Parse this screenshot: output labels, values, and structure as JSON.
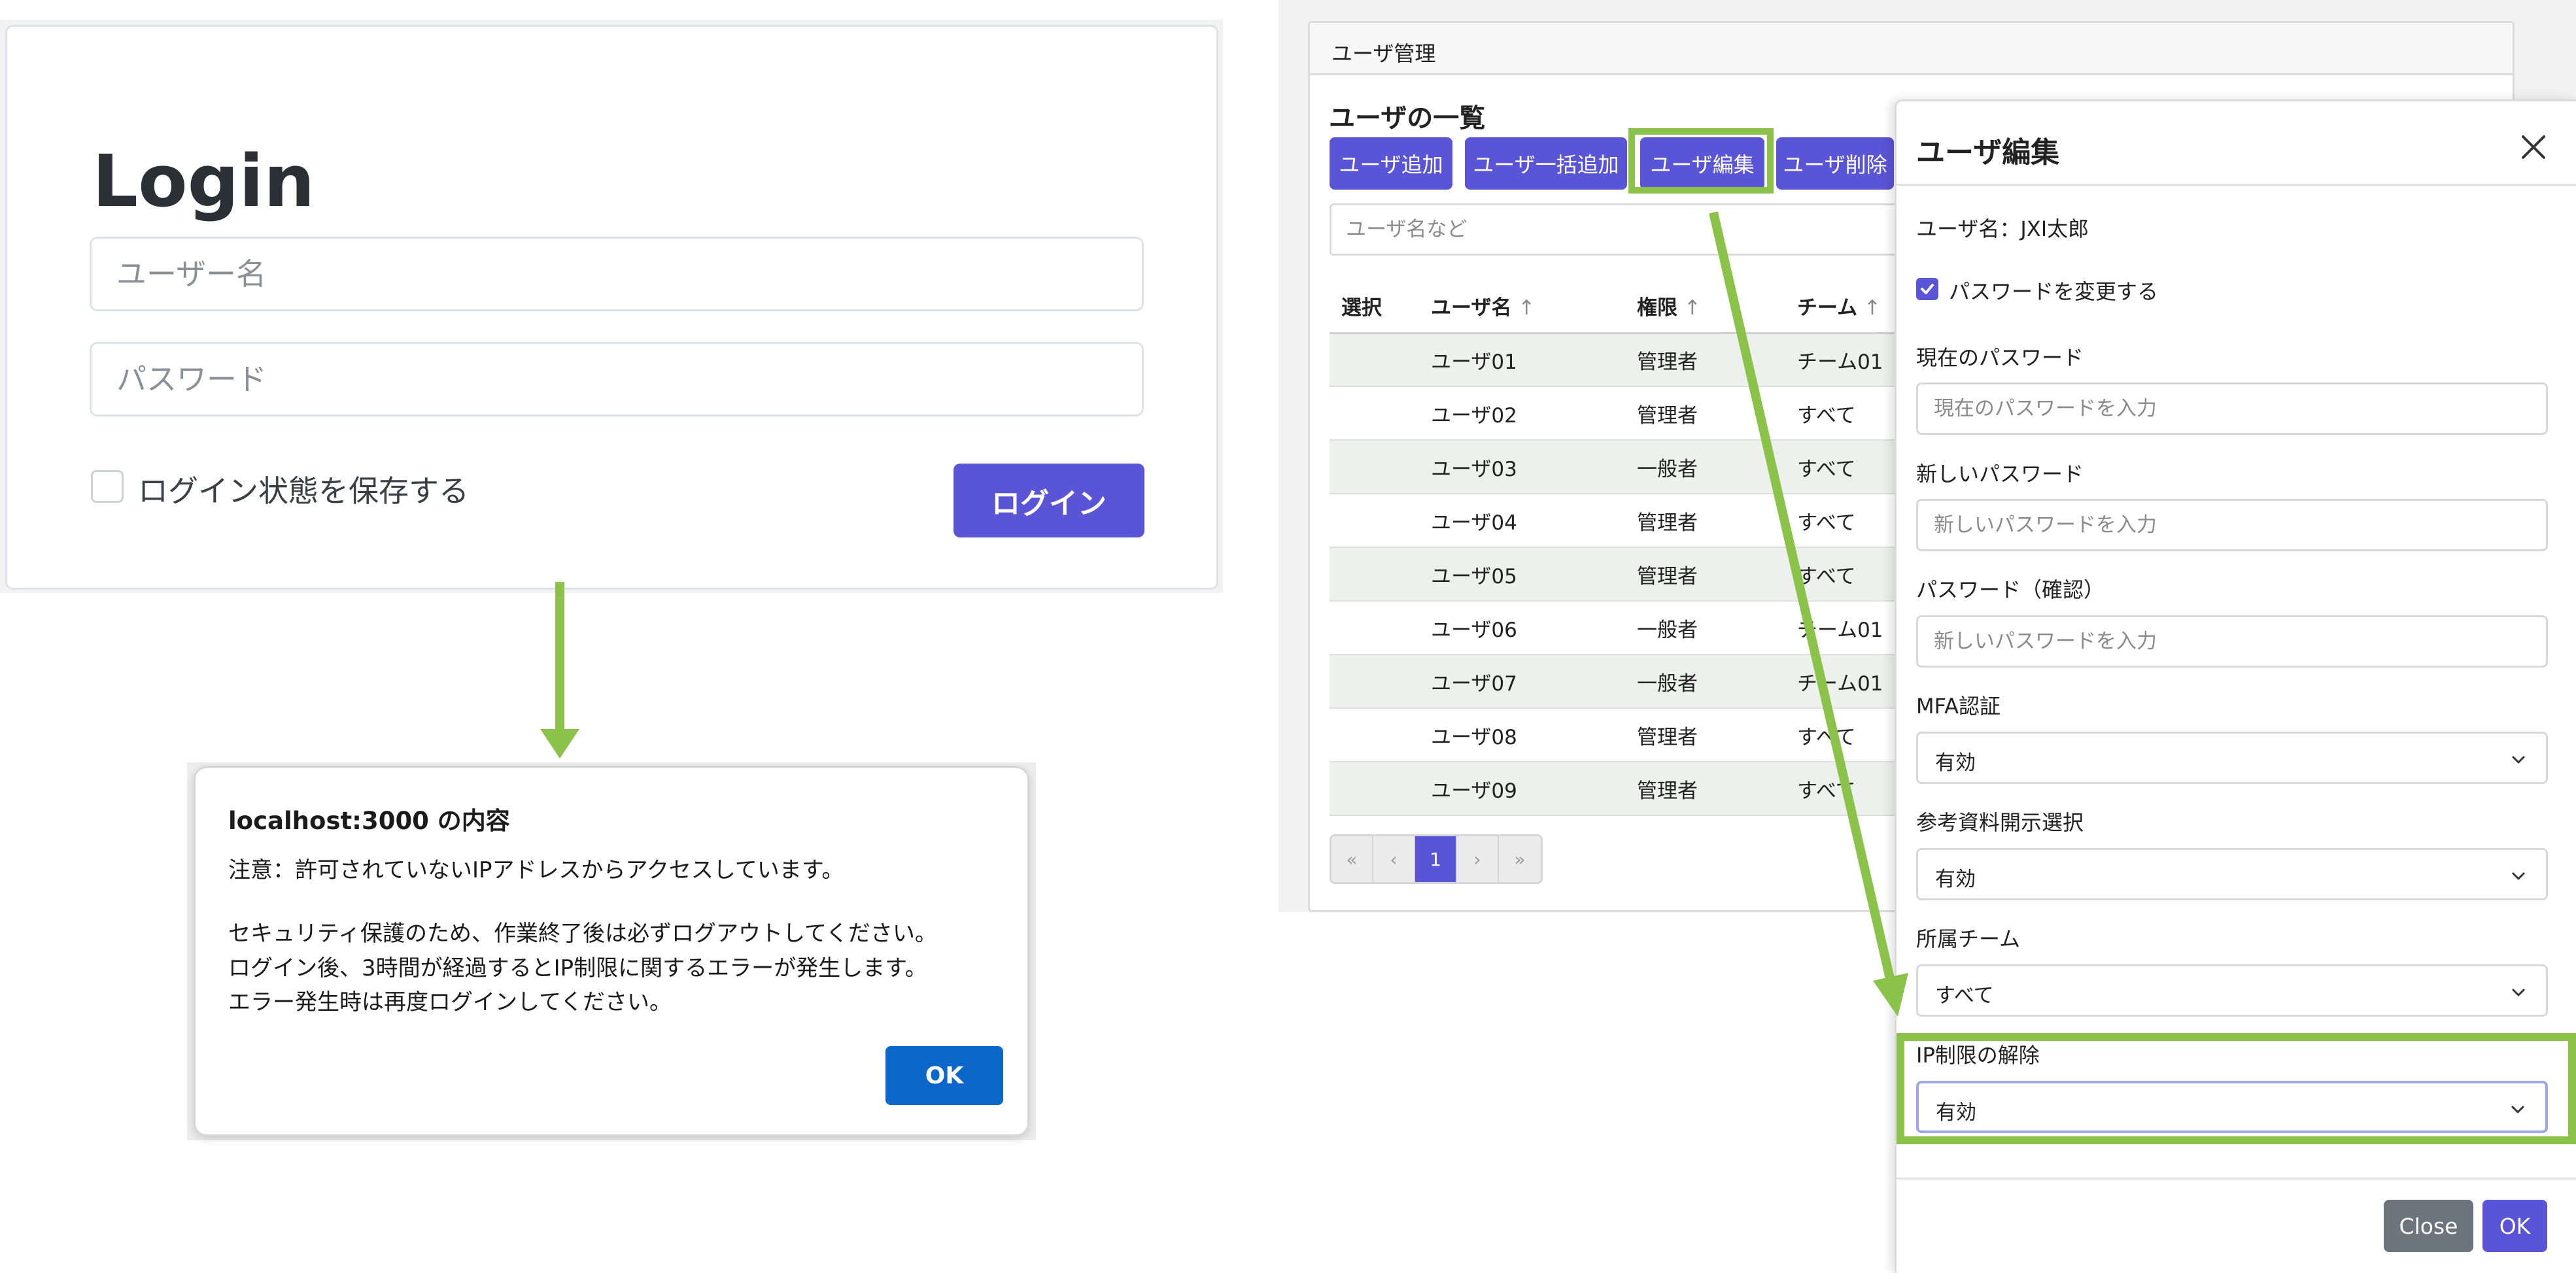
{
  "login": {
    "title": "Login",
    "username_placeholder": "ユーザー名",
    "password_placeholder": "パスワード",
    "remember_label": "ログイン状態を保存する",
    "login_button": "ログイン"
  },
  "alert": {
    "title": "localhost:3000 の内容",
    "lines": [
      "注意：許可されていないIPアドレスからアクセスしています。",
      "セキュリティ保護のため、作業終了後は必ずログアウトしてください。",
      "ログイン後、3時間が経過するとIP制限に関するエラーが発生します。",
      "エラー発生時は再度ログインしてください。"
    ],
    "ok_button": "OK"
  },
  "admin": {
    "header_title": "ユーザ管理",
    "list_title": "ユーザの一覧",
    "toolbar": {
      "add": "ユーザ追加",
      "bulk_add": "ユーザ一括追加",
      "edit": "ユーザ編集",
      "delete": "ユーザ削除"
    },
    "search_placeholder": "ユーザ名など",
    "table": {
      "headers": {
        "select": "選択",
        "name": "ユーザ名",
        "role": "権限",
        "team": "チーム"
      },
      "rows": [
        {
          "name": "ユーザ01",
          "role": "管理者",
          "team": "チーム01"
        },
        {
          "name": "ユーザ02",
          "role": "管理者",
          "team": "すべて"
        },
        {
          "name": "ユーザ03",
          "role": "一般者",
          "team": "すべて"
        },
        {
          "name": "ユーザ04",
          "role": "管理者",
          "team": "すべて"
        },
        {
          "name": "ユーザ05",
          "role": "管理者",
          "team": "すべて"
        },
        {
          "name": "ユーザ06",
          "role": "一般者",
          "team": "チーム01"
        },
        {
          "name": "ユーザ07",
          "role": "一般者",
          "team": "チーム01"
        },
        {
          "name": "ユーザ08",
          "role": "管理者",
          "team": "すべて"
        },
        {
          "name": "ユーザ09",
          "role": "管理者",
          "team": "すべて"
        }
      ]
    },
    "pagination": {
      "first": "«",
      "prev": "‹",
      "current": "1",
      "next": "›",
      "last": "»"
    }
  },
  "modal": {
    "title": "ユーザ編集",
    "username_line": "ユーザ名：JXI太郎",
    "change_password_label": "パスワードを変更する",
    "current_password_label": "現在のパスワード",
    "current_password_placeholder": "現在のパスワードを入力",
    "new_password_label": "新しいパスワード",
    "new_password_placeholder": "新しいパスワードを入力",
    "confirm_password_label": "パスワード（確認）",
    "confirm_password_placeholder": "新しいパスワードを入力",
    "mfa_label": "MFA認証",
    "mfa_value": "有効",
    "reference_label": "参考資料開示選択",
    "reference_value": "有効",
    "team_label": "所属チーム",
    "team_value": "すべて",
    "ip_label": "IP制限の解除",
    "ip_value": "有効",
    "close_button": "Close",
    "ok_button": "OK"
  },
  "colors": {
    "primary": "#5a54d6",
    "alert_ok": "#0b67c8",
    "highlight": "#8bc34a",
    "secondary": "#6b757e"
  }
}
